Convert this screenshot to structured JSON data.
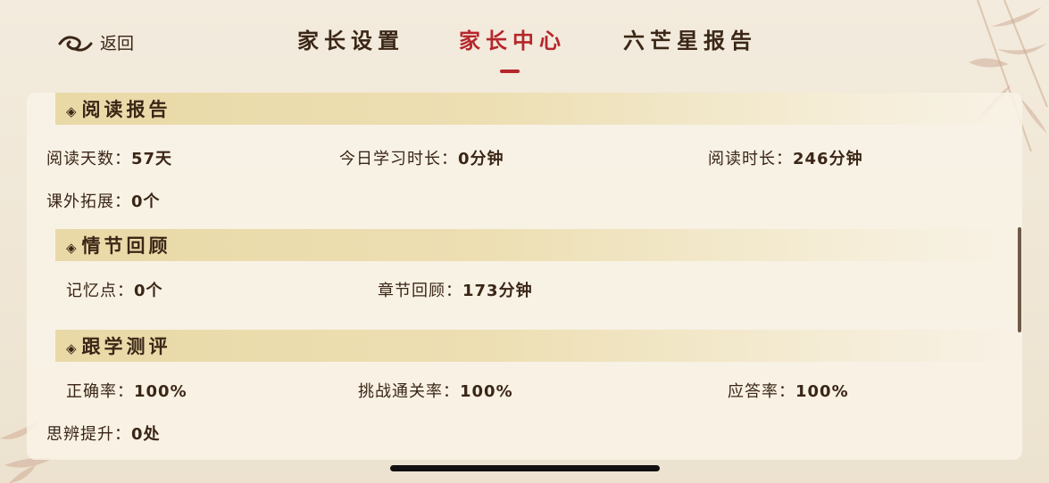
{
  "header": {
    "back_label": "返回",
    "tabs": [
      {
        "label": "家长设置",
        "active": false
      },
      {
        "label": "家长中心",
        "active": true
      },
      {
        "label": "六芒星报告",
        "active": false
      }
    ]
  },
  "colors": {
    "accent": "#b5262b",
    "text": "#3a2616",
    "section_band": "#e9d9a7",
    "background": "#f3ebdd"
  },
  "sections": {
    "reading": {
      "title": "阅读报告",
      "stats": {
        "days": {
          "label": "阅读天数：",
          "value": "57天"
        },
        "today": {
          "label": "今日学习时长：",
          "value": "0分钟"
        },
        "duration": {
          "label": "阅读时长：",
          "value": "246分钟"
        },
        "extra": {
          "label": "课外拓展：",
          "value": "0个"
        }
      }
    },
    "plot": {
      "title": "情节回顾",
      "stats": {
        "memory": {
          "label": "记忆点：",
          "value": "0个"
        },
        "chapter": {
          "label": "章节回顾：",
          "value": "173分钟"
        }
      }
    },
    "quiz": {
      "title": "跟学测评",
      "stats": {
        "accuracy": {
          "label": "正确率：",
          "value": "100%"
        },
        "challenge": {
          "label": "挑战通关率：",
          "value": "100%"
        },
        "response": {
          "label": "应答率：",
          "value": "100%"
        },
        "thinking": {
          "label": "思辨提升：",
          "value": "0处"
        }
      }
    }
  }
}
